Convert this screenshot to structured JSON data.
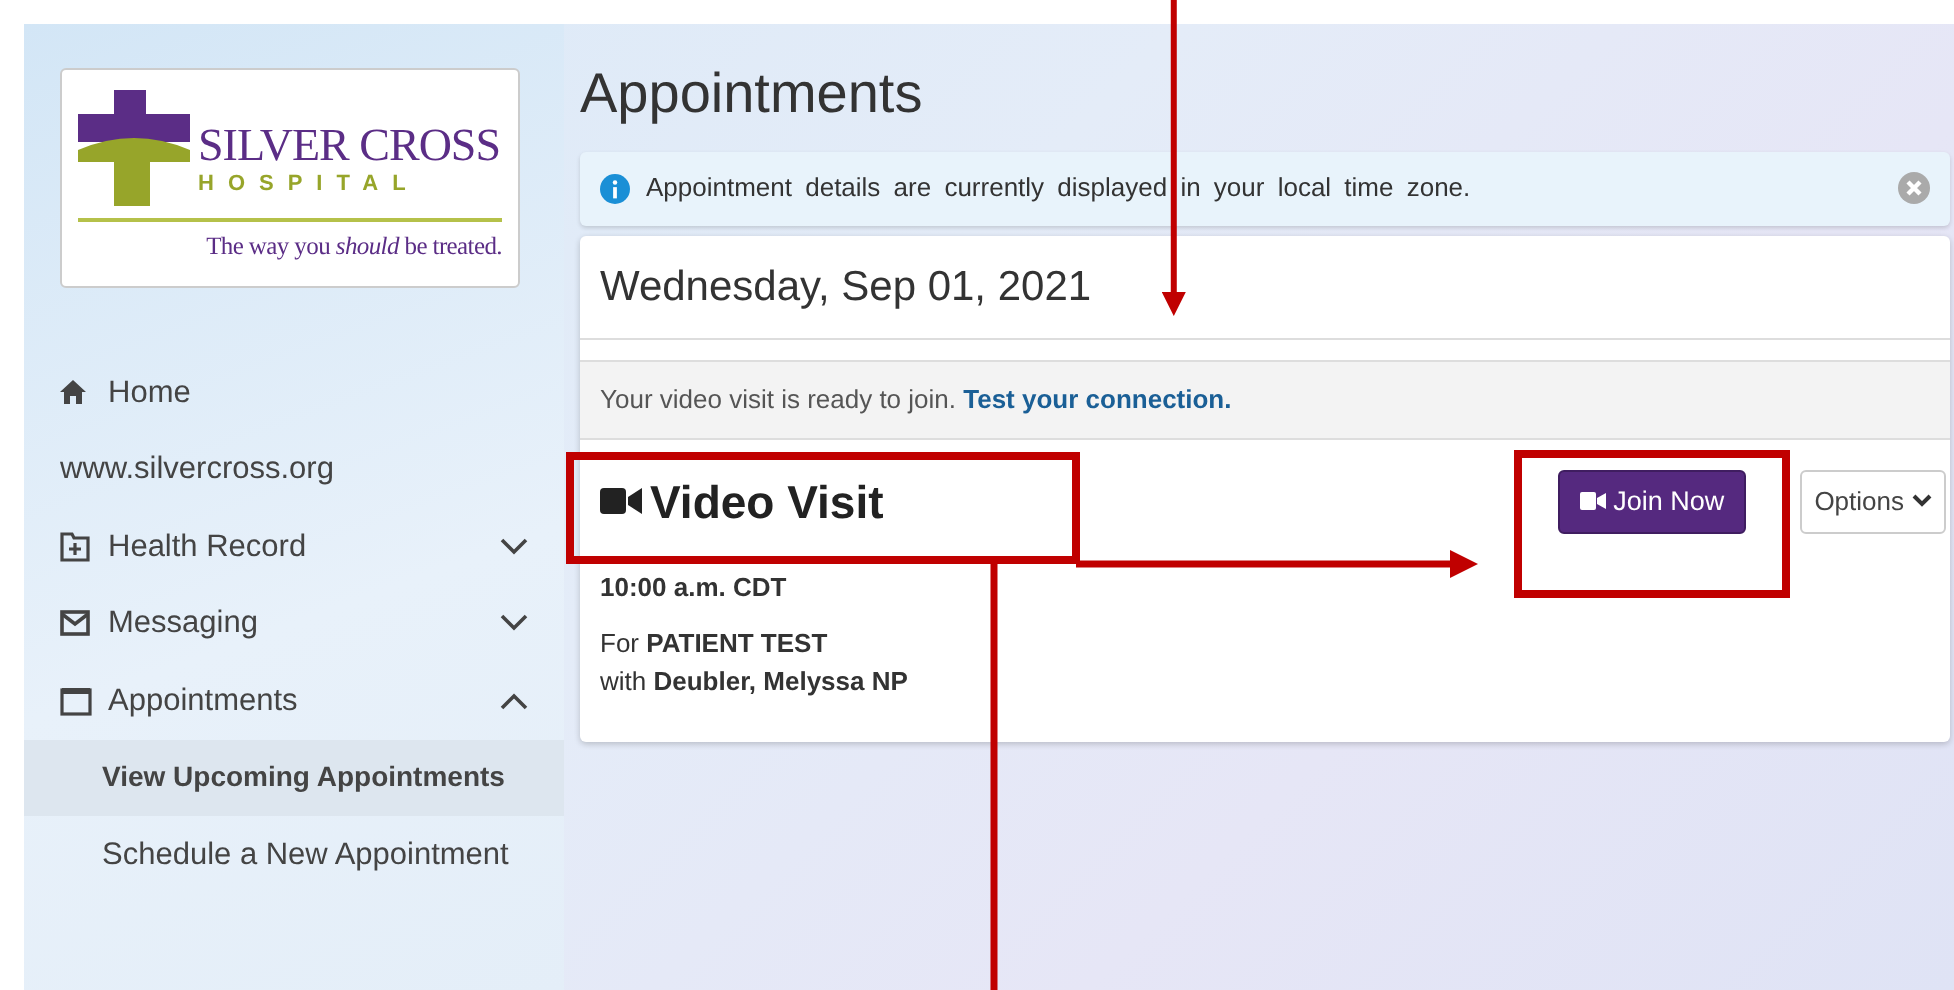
{
  "logo": {
    "name": "SILVER CROSS",
    "subtitle": "HOSPITAL",
    "tagline": "The way you *should* be treated."
  },
  "sidebar": {
    "items": [
      {
        "kind": "link",
        "label": "Home"
      },
      {
        "kind": "plain",
        "label": "www.silvercross.org"
      },
      {
        "kind": "group",
        "label": "Health Record",
        "expanded": false
      },
      {
        "kind": "group",
        "label": "Messaging",
        "expanded": false
      },
      {
        "kind": "group",
        "label": "Appointments",
        "expanded": true,
        "children": [
          {
            "label": "View Upcoming Appointments",
            "selected": true
          },
          {
            "label": "Schedule a New Appointment",
            "selected": false
          }
        ]
      }
    ]
  },
  "page_title": "Appointments",
  "alert": {
    "text": "Appointment details are currently displayed in your local time zone."
  },
  "appointment": {
    "date": "Wednesday, Sep 01, 2021",
    "notice": "Your video visit is ready to join.",
    "notice_link": "Test your connection.",
    "title": "Video Visit",
    "time": "10:00 a.m. CDT",
    "for_label": "For",
    "patient": "PATIENT TEST",
    "with_label": "with",
    "provider": "Deubler, Melyssa NP",
    "join_button": "Join Now",
    "options_button": "Options"
  }
}
